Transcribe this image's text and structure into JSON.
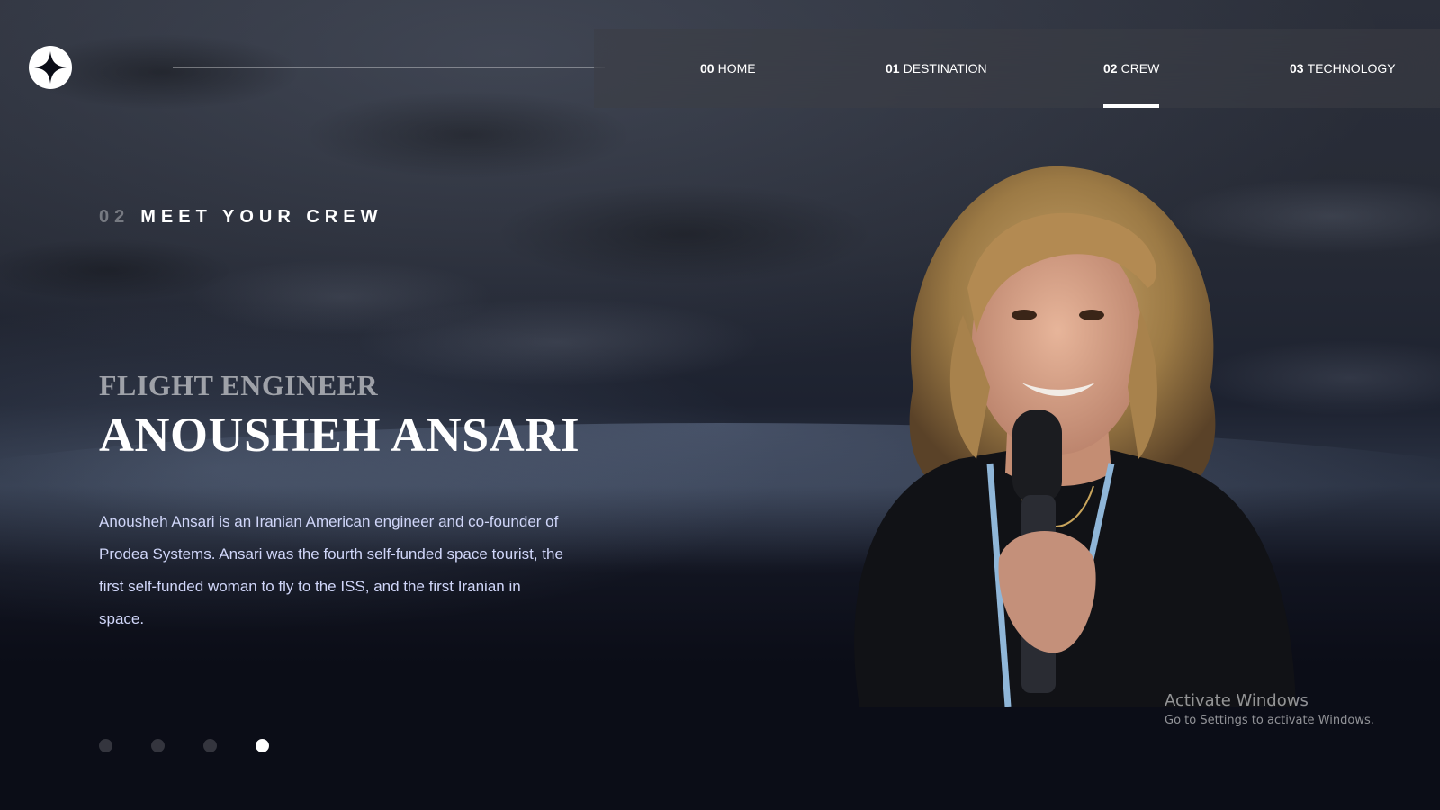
{
  "header": {
    "nav": [
      {
        "num": "00",
        "label": "HOME",
        "active": false
      },
      {
        "num": "01",
        "label": "DESTINATION",
        "active": false
      },
      {
        "num": "02",
        "label": "CREW",
        "active": true
      },
      {
        "num": "03",
        "label": "TECHNOLOGY",
        "active": false
      }
    ]
  },
  "heading": {
    "num": "02",
    "text": "MEET YOUR CREW"
  },
  "crew": {
    "role": "FLIGHT ENGINEER",
    "name": "ANOUSHEH ANSARI",
    "bio": "Anousheh Ansari is an Iranian American engineer and co-founder of Prodea Systems. Ansari was the fourth self-funded space tourist, the first self-funded woman to fly to the ISS, and the first Iranian in space.",
    "selected_index": 3,
    "total": 4
  },
  "watermark": {
    "title": "Activate Windows",
    "subtitle": "Go to Settings to activate Windows."
  },
  "colors": {
    "background": "#0b0d17",
    "text_light": "#d0d6f9",
    "accent": "#ffffff"
  }
}
